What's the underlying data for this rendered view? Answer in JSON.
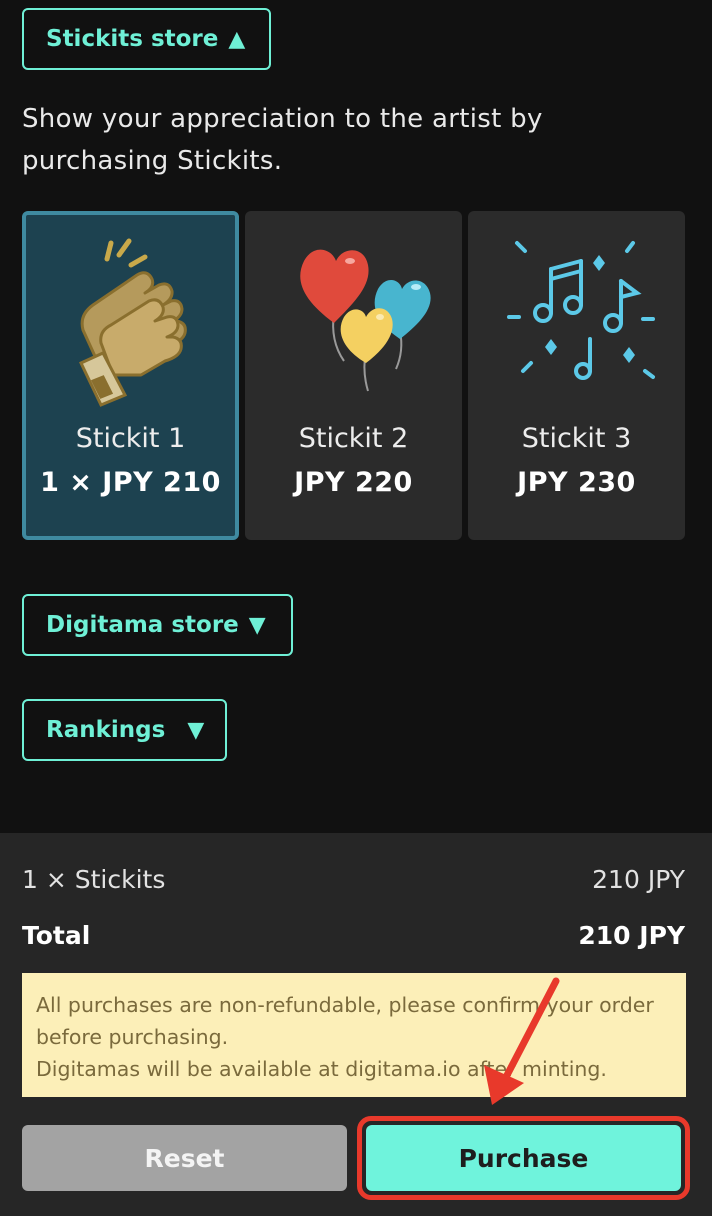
{
  "store": {
    "stickits_toggle": "Stickits store",
    "stickits_arrow": "▲",
    "intro_text": "Show your appreciation to the artist by purchasing Stickits.",
    "items": [
      {
        "name": "Stickit 1",
        "price": "1 × JPY 210",
        "icon": "clapping-hands-icon",
        "selected": true
      },
      {
        "name": "Stickit 2",
        "price": "JPY 220",
        "icon": "balloons-icon",
        "selected": false
      },
      {
        "name": "Stickit 3",
        "price": "JPY 230",
        "icon": "music-notes-icon",
        "selected": false
      }
    ],
    "digitama_toggle": "Digitama store",
    "digitama_arrow": "▼",
    "rankings_toggle": "Rankings",
    "rankings_arrow": "▼"
  },
  "summary": {
    "line_label": "1 × Stickits",
    "line_amount": "210 JPY",
    "total_label": "Total",
    "total_amount": "210 JPY",
    "notice_line1": "All purchases are non-refundable, please confirm your order before purchasing.",
    "notice_line2": "Digitamas will be available at digitama.io after minting.",
    "reset_label": "Reset",
    "purchase_label": "Purchase"
  },
  "colors": {
    "accent": "#6ff0d6",
    "selected_card": "#1d4250",
    "annotation": "#e8392b"
  }
}
